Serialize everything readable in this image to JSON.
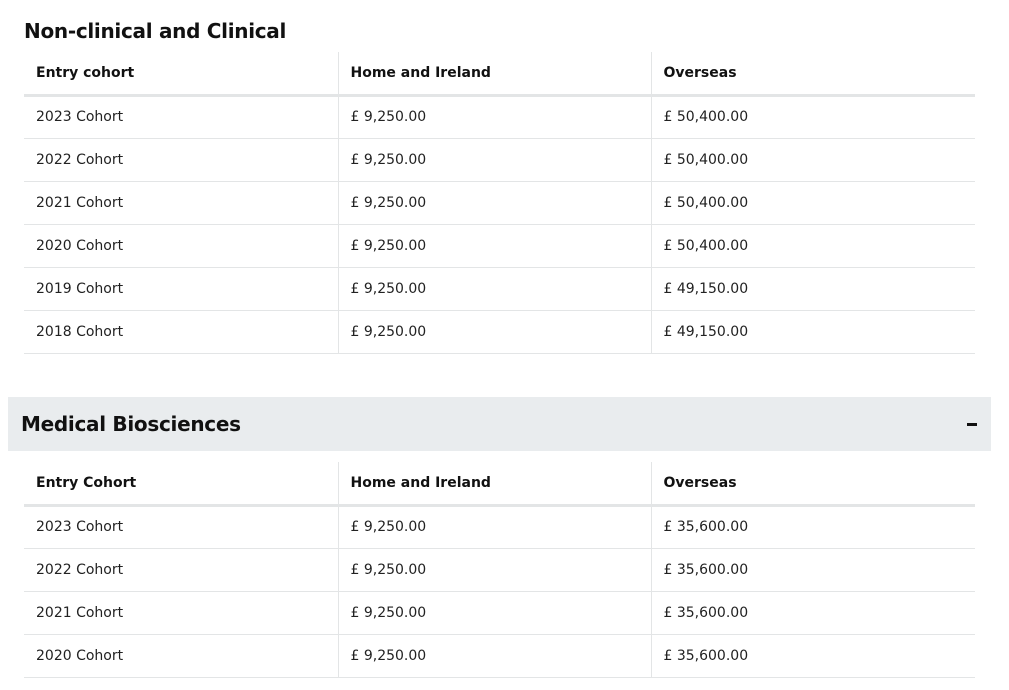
{
  "section1": {
    "title": "Non-clinical and Clinical",
    "headers": [
      "Entry cohort",
      "Home and Ireland",
      "Overseas"
    ],
    "rows": [
      [
        "2023 Cohort",
        "£ 9,250.00",
        "£ 50,400.00"
      ],
      [
        "2022 Cohort",
        "£ 9,250.00",
        "£ 50,400.00"
      ],
      [
        "2021 Cohort",
        "£ 9,250.00",
        "£ 50,400.00"
      ],
      [
        "2020 Cohort",
        "£ 9,250.00",
        "£ 50,400.00"
      ],
      [
        "2019 Cohort",
        "£ 9,250.00",
        "£ 49,150.00"
      ],
      [
        "2018 Cohort",
        "£ 9,250.00",
        "£ 49,150.00"
      ]
    ]
  },
  "section2": {
    "title": "Medical Biosciences",
    "toggle_icon": "minus-icon",
    "headers": [
      "Entry Cohort",
      "Home and Ireland",
      "Overseas"
    ],
    "rows": [
      [
        "2023 Cohort",
        "£ 9,250.00",
        "£ 35,600.00"
      ],
      [
        "2022 Cohort",
        "£ 9,250.00",
        "£ 35,600.00"
      ],
      [
        "2021 Cohort",
        "£ 9,250.00",
        "£ 35,600.00"
      ],
      [
        "2020 Cohort",
        "£ 9,250.00",
        "£ 35,600.00"
      ]
    ]
  },
  "colors": {
    "accordion_bg": "#e9ecee",
    "border": "#e3e5e6",
    "text": "#111111"
  }
}
